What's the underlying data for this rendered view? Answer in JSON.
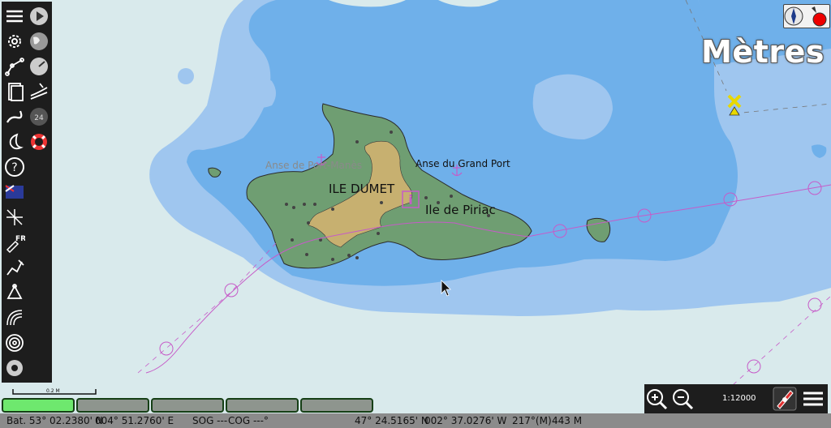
{
  "map": {
    "units_label": "Mètres",
    "labels": {
      "island_name": "ILE DUMET",
      "town": "Ile de Piriac",
      "anse_port_manes": "Anse de Port-Manès",
      "anse_grand_port": "Anse du Grand Port",
      "scale_bar": "0.2 M"
    },
    "scale": "1:12000",
    "colors": {
      "land": "#6f9e72",
      "built_up": "#c7b070",
      "deep_water": "#d9eaec",
      "medium_water": "#9fc6ef",
      "shallow_water": "#6fb0ea",
      "route": "#c65bc8"
    }
  },
  "sidebar": {
    "buttons": [
      "menu-icon",
      "play-icon",
      "settings-icon",
      "globe-icon",
      "route-icon",
      "gauge-icon",
      "document-icon",
      "tide-icon",
      "track-icon",
      "ais-icon",
      "night-mode-icon",
      "lifebuoy-icon",
      "help-icon",
      "flag-icon",
      "chart-tools-icon",
      "language-icon",
      "edit-route-icon",
      "waypoint-icon",
      "radar-icon",
      "target-icon",
      "record-icon"
    ],
    "language": "FR"
  },
  "tabs": {
    "count": 5,
    "active_index": 0
  },
  "status": {
    "bat_lat": "Bat. 53° 02.2380' N",
    "bat_lon": "004° 51.2760' E",
    "sog": "SOG ---",
    "cog": "COG ---°",
    "cursor_lat": "47° 24.5165' N",
    "cursor_lon": "002° 37.0276' W",
    "bearing": "217°(M)",
    "distance": "443 M"
  }
}
